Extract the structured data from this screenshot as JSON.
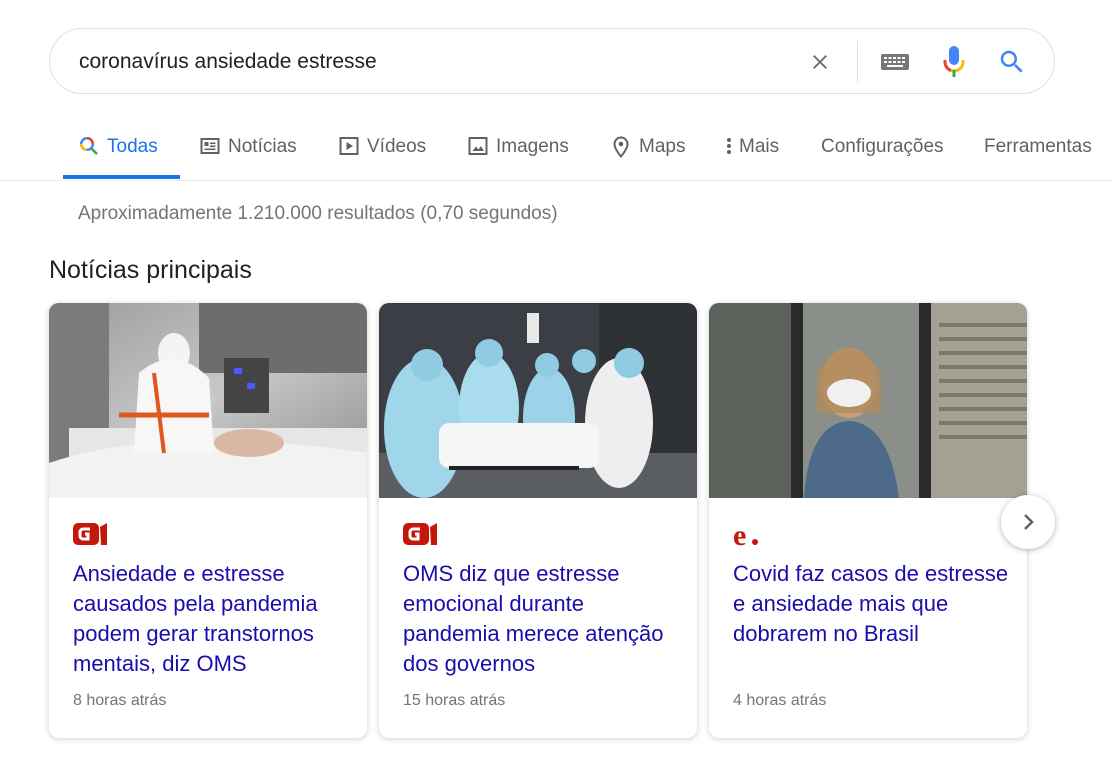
{
  "search": {
    "query": "coronavírus ansiedade estresse",
    "icons": [
      "close-icon",
      "keyboard-icon",
      "microphone-icon",
      "search-icon"
    ]
  },
  "tabs": [
    {
      "label": "Todas",
      "icon": "search-icon",
      "active": true
    },
    {
      "label": "Notícias",
      "icon": "news-icon"
    },
    {
      "label": "Vídeos",
      "icon": "play-icon"
    },
    {
      "label": "Imagens",
      "icon": "image-icon"
    },
    {
      "label": "Maps",
      "icon": "map-pin-icon"
    },
    {
      "label": "Mais",
      "icon": "more-vert-icon"
    },
    {
      "label": "Configurações"
    },
    {
      "label": "Ferramentas"
    }
  ],
  "results": {
    "count_text": "Aproximadamente 1.210.000 resultados (0,70 segundos)"
  },
  "top_stories": {
    "title": "Notícias principais",
    "cards": [
      {
        "source": "G1",
        "headline": "Ansiedade e estresse causados pela pandemia podem gerar transtornos mentais, diz OMS",
        "age": "8 horas atrás",
        "image": "photo-hospital-patient"
      },
      {
        "source": "G1",
        "headline": "OMS diz que estresse emocional durante pandemia merece atenção dos governos",
        "age": "15 horas atrás",
        "image": "photo-medical-team-stretcher"
      },
      {
        "source": "e.",
        "headline": "Covid faz casos de estresse e ansiedade mais que dobrarem no Brasil",
        "age": "4 horas atrás",
        "image": "photo-masked-woman-window"
      }
    ]
  },
  "colors": {
    "accent": "#1a73e8",
    "link": "#1a0dab",
    "muted": "#70757a",
    "g1_red": "#c4170c"
  }
}
